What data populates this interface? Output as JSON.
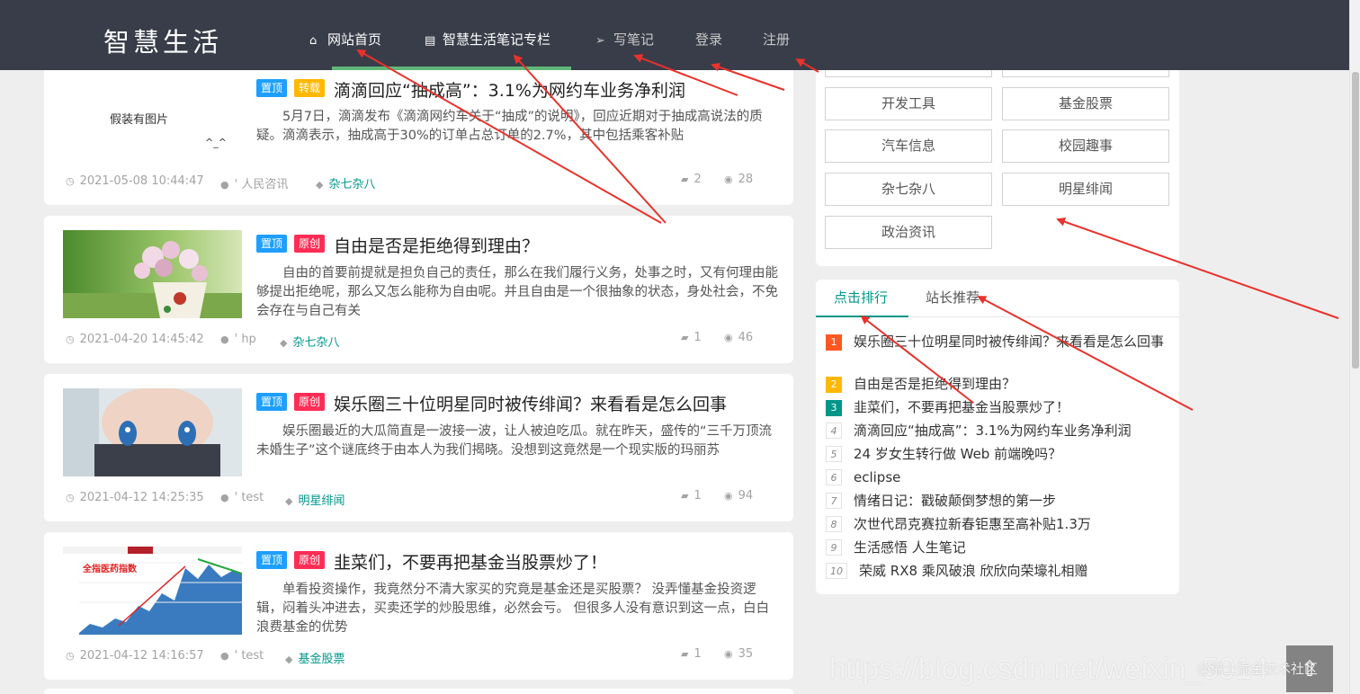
{
  "header": {
    "logo": "智慧生活",
    "nav": [
      {
        "label": "网站首页",
        "icon": "home-icon",
        "glyph": "⌂"
      },
      {
        "label": "智慧生活笔记专栏",
        "icon": "document-icon",
        "glyph": "▤"
      },
      {
        "label": "写笔记",
        "icon": "paper-plane-icon",
        "glyph": "➢"
      },
      {
        "label": "登录"
      },
      {
        "label": "注册"
      }
    ]
  },
  "articles": [
    {
      "badges": [
        "置顶",
        "转载"
      ],
      "title": "滴滴回应“抽成高”：3.1%为网约车业务净利润",
      "summary": "5月7日，滴滴发布《滴滴网约车关于“抽成”的说明》，回应近期对于抽成高说法的质疑。滴滴表示，抽成高于30%的订单占总订单的2.7%，其中包括乘客补贴",
      "thumb_text": "假装有图片",
      "thumb_face": "^_^",
      "date": "2021-05-08 10:44:47",
      "author": "人民咨讯",
      "category": "杂七杂八",
      "comments": "2",
      "views": "28"
    },
    {
      "badges": [
        "置顶",
        "原创"
      ],
      "title": "自由是否是拒绝得到理由？",
      "summary": "自由的首要前提就是担负自己的责任，那么在我们履行义务，处事之时，又有何理由能够提出拒绝呢，那么又怎么能称为自由呢。并且自由是一个很抽象的状态，身处社会，不免会存在与自己有关",
      "date": "2021-04-20 14:45:42",
      "author": "hp",
      "category": "杂七杂八",
      "comments": "1",
      "views": "46"
    },
    {
      "badges": [
        "置顶",
        "原创"
      ],
      "title": "娱乐圈三十位明星同时被传绯闻？来看看是怎么回事",
      "summary": "娱乐圈最近的大瓜简直是一波接一波，让人被迫吃瓜。就在昨天，盛传的“三千万顶流未婚生子”这个谜底终于由本人为我们揭晓。没想到这竟然是一个现实版的玛丽苏",
      "date": "2021-04-12 14:25:35",
      "author": "test",
      "category": "明星绯闻",
      "comments": "1",
      "views": "94"
    },
    {
      "badges": [
        "置顶",
        "原创"
      ],
      "title": "韭菜们，不要再把基金当股票炒了！",
      "summary": "单看投资操作，我竟然分不清大家买的究竟是基金还是买股票？ 没弄懂基金投资逻辑，闷着头冲进去，买卖还学的炒股思维，必然会亏。 但很多人没有意识到这一点，白白浪费基金的优势",
      "thumb_text": "全指医药指数",
      "date": "2021-04-12 14:16:57",
      "author": "test",
      "category": "基金股票",
      "comments": "1",
      "views": "35"
    }
  ],
  "categories": [
    "开发工具",
    "基金股票",
    "汽车信息",
    "校园趣事",
    "杂七杂八",
    "明星绯闻",
    "政治资讯"
  ],
  "tabs": [
    "点击排行",
    "站长推荐"
  ],
  "ranking": [
    "娱乐圈三十位明星同时被传绯闻？来看看是怎么回事",
    "自由是否是拒绝得到理由？",
    "韭菜们，不要再把基金当股票炒了！",
    "滴滴回应“抽成高”：3.1%为网约车业务净利润",
    "24 岁女生转行做 Web 前端晚吗？",
    "eclipse",
    "情绪日记：戳破颠倒梦想的第一步",
    "次世代昂克赛拉新春钜惠至高补贴1.3万",
    "生活感悟 人生笔记",
    "荣威 RX8 乘风破浪 欣欣向荣壕礼相赠"
  ],
  "watermark": "https://blog.csdn.net/weixin_5014",
  "watermark2": "@稀土掘金技术社区",
  "colors": {
    "header_bg": "#393d49",
    "accent_green": "#009688",
    "nav_underline": "#5fb878",
    "badge_top": "#1e9fff",
    "badge_repost": "#ffb800",
    "badge_original": "#ff2d55",
    "annotation_arrow": "#e8322c"
  }
}
